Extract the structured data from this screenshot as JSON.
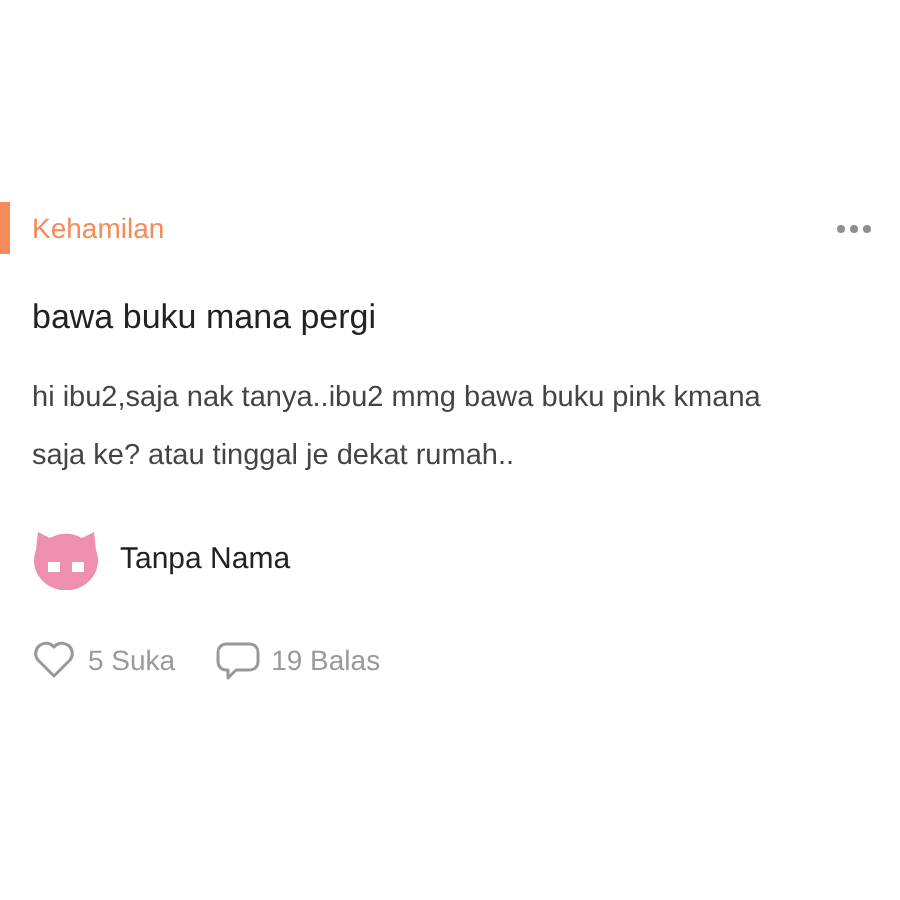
{
  "category": "Kehamilan",
  "title": "bawa buku mana pergi",
  "body": "hi ibu2,saja nak tanya..ibu2 mmg bawa buku pink kmana saja ke? atau tinggal je dekat rumah..",
  "author": {
    "name": "Tanpa Nama"
  },
  "likes": "5 Suka",
  "replies": "19 Balas"
}
